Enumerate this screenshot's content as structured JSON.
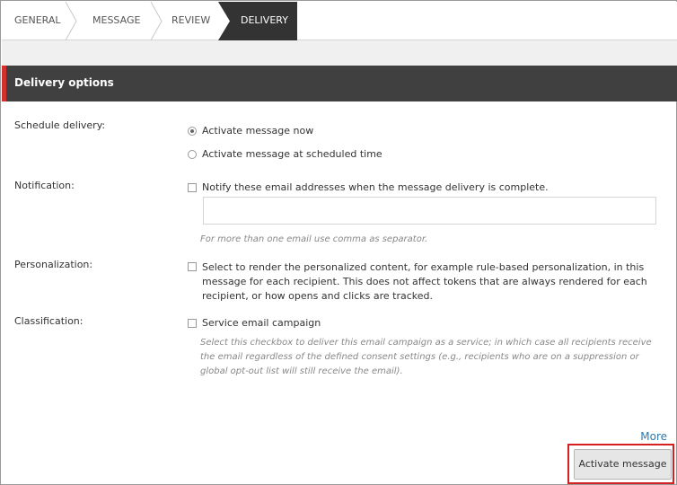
{
  "wizard": {
    "steps": [
      {
        "label": "GENERAL",
        "active": false
      },
      {
        "label": "MESSAGE",
        "active": false
      },
      {
        "label": "REVIEW",
        "active": false
      },
      {
        "label": "DELIVERY",
        "active": true
      }
    ]
  },
  "section": {
    "title": "Delivery options"
  },
  "schedule": {
    "label": "Schedule delivery:",
    "options": [
      {
        "label": "Activate message now",
        "selected": true
      },
      {
        "label": "Activate message at scheduled time",
        "selected": false
      }
    ]
  },
  "notification": {
    "label": "Notification:",
    "checkbox_label": "Notify these email addresses when the message delivery is complete.",
    "checked": false,
    "email_value": "",
    "hint": "For more than one email use comma as separator."
  },
  "personalization": {
    "label": "Personalization:",
    "checkbox_label": "Select to render the personalized content, for example rule-based personalization, in this message for each recipient. This does not affect tokens that are always rendered for each recipient, or how opens and clicks are tracked.",
    "checked": false
  },
  "classification": {
    "label": "Classification:",
    "checkbox_label": "Service email campaign",
    "checked": false,
    "hint": "Select this checkbox to deliver this email campaign as a service; in which case all recipients receive the email regardless of the defined consent settings (e.g., recipients who are on a suppression or global opt-out list will still receive the email)."
  },
  "footer": {
    "more_label": "More",
    "activate_label": "Activate message"
  },
  "colors": {
    "accent_red": "#d0312d",
    "header_dark": "#404040",
    "link_blue": "#2a7ab0"
  }
}
